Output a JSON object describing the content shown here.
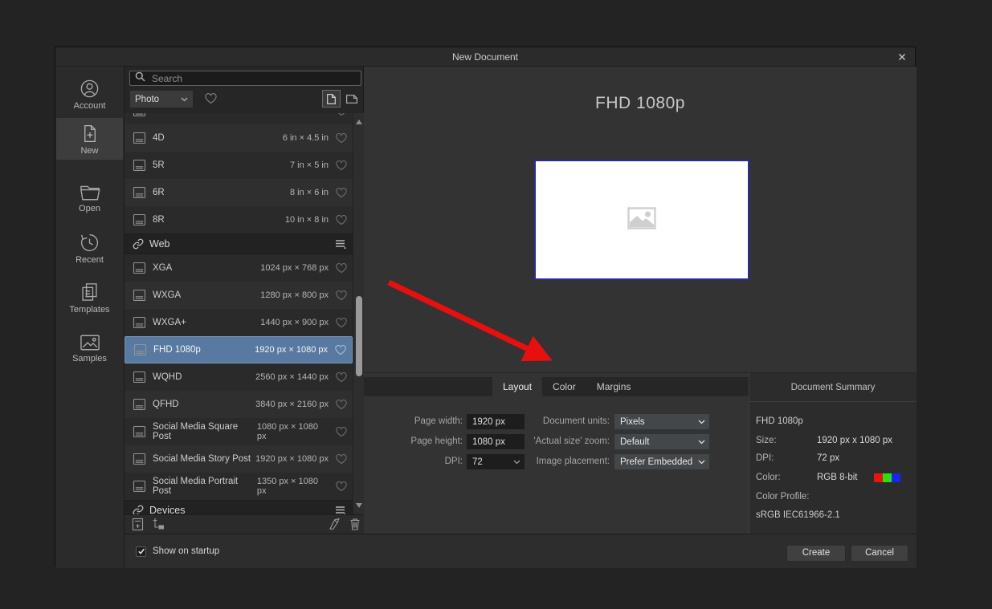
{
  "window": {
    "title": "New Document"
  },
  "sidebar": {
    "items": [
      {
        "id": "account",
        "label": "Account",
        "selected": false
      },
      {
        "id": "new",
        "label": "New",
        "selected": true
      },
      {
        "id": "open",
        "label": "Open",
        "selected": false
      },
      {
        "id": "recent",
        "label": "Recent",
        "selected": false
      },
      {
        "id": "templates",
        "label": "Templates",
        "selected": false
      },
      {
        "id": "samples",
        "label": "Samples",
        "selected": false
      }
    ]
  },
  "presets": {
    "search_placeholder": "Search",
    "category": "Photo",
    "rows": [
      {
        "type": "preset",
        "name": "",
        "size": "",
        "partial": true
      },
      {
        "type": "preset",
        "name": "4D",
        "size": "6 in × 4.5 in"
      },
      {
        "type": "preset",
        "name": "5R",
        "size": "7 in × 5 in"
      },
      {
        "type": "preset",
        "name": "6R",
        "size": "8 in × 6 in"
      },
      {
        "type": "preset",
        "name": "8R",
        "size": "10 in × 8 in"
      },
      {
        "type": "section",
        "name": "Web"
      },
      {
        "type": "preset",
        "name": "XGA",
        "size": "1024 px × 768 px"
      },
      {
        "type": "preset",
        "name": "WXGA",
        "size": "1280 px × 800 px"
      },
      {
        "type": "preset",
        "name": "WXGA+",
        "size": "1440 px × 900 px"
      },
      {
        "type": "preset",
        "name": "FHD 1080p",
        "size": "1920 px × 1080 px",
        "selected": true
      },
      {
        "type": "preset",
        "name": "WQHD",
        "size": "2560 px × 1440 px"
      },
      {
        "type": "preset",
        "name": "QFHD",
        "size": "3840 px × 2160 px"
      },
      {
        "type": "preset",
        "name": "Social Media Square Post",
        "size": "1080 px × 1080 px"
      },
      {
        "type": "preset",
        "name": "Social Media Story Post",
        "size": "1920 px × 1080 px"
      },
      {
        "type": "preset",
        "name": "Social Media Portrait Post",
        "size": "1350 px × 1080 px"
      },
      {
        "type": "section",
        "name": "Devices"
      }
    ]
  },
  "preview": {
    "heading": "FHD 1080p"
  },
  "tabs": [
    {
      "label": "Layout",
      "active": true
    },
    {
      "label": "Color",
      "active": false
    },
    {
      "label": "Margins",
      "active": false
    }
  ],
  "form": {
    "page_width_label": "Page width:",
    "page_width": "1920 px",
    "page_height_label": "Page height:",
    "page_height": "1080 px",
    "dpi_label": "DPI:",
    "dpi": "72",
    "document_units_label": "Document units:",
    "document_units": "Pixels",
    "actual_size_zoom_label": "'Actual size' zoom:",
    "actual_size_zoom": "Default",
    "image_placement_label": "Image placement:",
    "image_placement": "Prefer Embedded"
  },
  "summary": {
    "title": "Document Summary",
    "name": "FHD 1080p",
    "size_label": "Size:",
    "size_value": "1920 px  x  1080 px",
    "dpi_label": "DPI:",
    "dpi_value": "72 px",
    "color_label": "Color:",
    "color_value": "RGB 8-bit",
    "color_swatches": [
      "#e9150b",
      "#27e20e",
      "#1626f0"
    ],
    "profile_label": "Color Profile:",
    "profile_value": "sRGB IEC61966-2.1"
  },
  "footer": {
    "show_on_startup_label": "Show on startup",
    "show_on_startup_checked": true,
    "create_label": "Create",
    "cancel_label": "Cancel"
  },
  "colors": {
    "selection_blue": "#587aa0",
    "annotation_arrow_red": "#e8100e",
    "preview_border_navy": "#2a2a9a"
  }
}
